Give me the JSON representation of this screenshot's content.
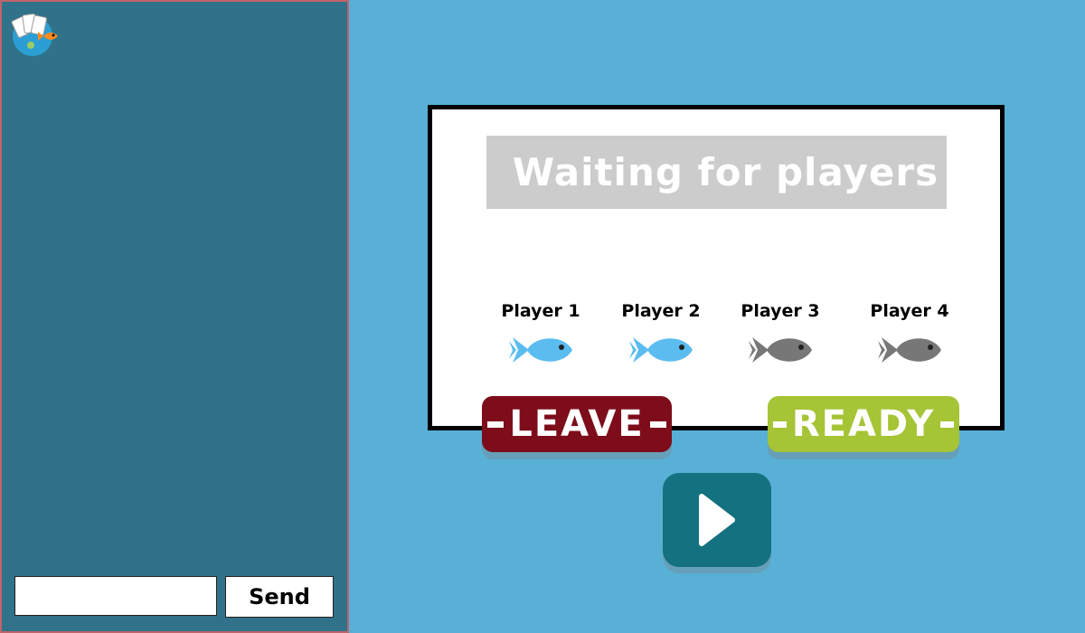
{
  "chat": {
    "input_value": "",
    "input_placeholder": "",
    "send_label": "Send"
  },
  "lobby": {
    "title": "Waiting for players",
    "players": [
      {
        "label": "Player 1",
        "joined": true
      },
      {
        "label": "Player 2",
        "joined": true
      },
      {
        "label": "Player 3",
        "joined": false
      },
      {
        "label": "Player 4",
        "joined": false
      }
    ]
  },
  "actions": {
    "leave_label": "LEAVE",
    "ready_label": "READY",
    "play_icon": "play-icon"
  },
  "colors": {
    "background": "#58b0d6",
    "chat_panel": "#307289",
    "fish_joined": "#5bbcf0",
    "fish_empty": "#777777",
    "leave": "#7d0d1a",
    "ready": "#a5c436",
    "play": "#14717f"
  },
  "icons": {
    "logo": "fish-cards-logo",
    "fish": "fish-icon"
  }
}
